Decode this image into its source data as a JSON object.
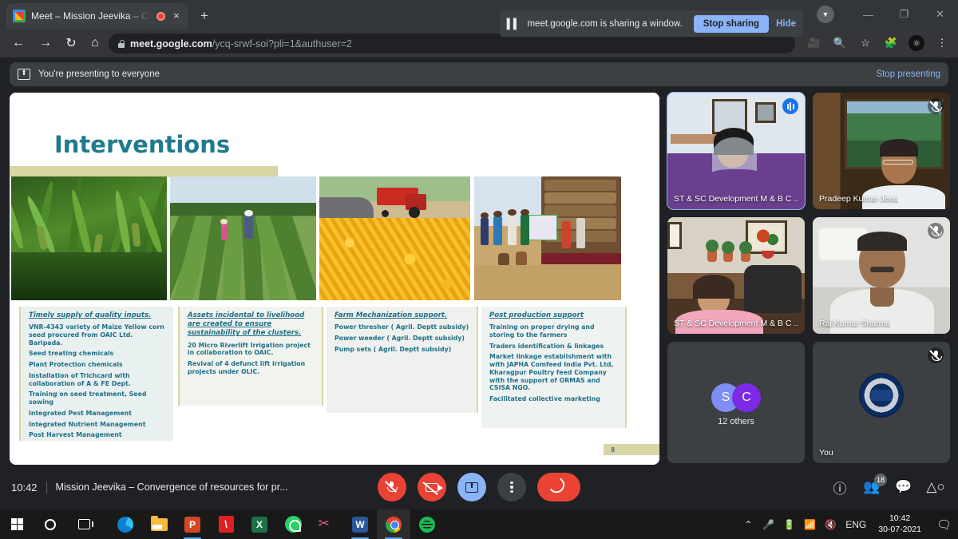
{
  "browser": {
    "tab": {
      "title": "Meet – Mission Jeevika – Co",
      "favicon": "meet-favicon-icon",
      "recording_indicator": "recording-dot-icon",
      "close": "×"
    },
    "new_tab_label": "+",
    "nav": {
      "back": "←",
      "forward": "→",
      "reload": "↻",
      "home": "⌂"
    },
    "omnibox": {
      "secure_icon": "lock-icon",
      "url_host": "meet.google.com",
      "url_path": "/ycq-srwf-soi?pli=1&authuser=2"
    },
    "toolbar_icons": [
      "camera-icon",
      "search-icon",
      "star-icon",
      "extensions-icon",
      "profile-avatar-icon",
      "menu-icon"
    ],
    "window_controls": {
      "minimize": "—",
      "maximize": "❐",
      "close": "✕"
    },
    "profile_chip": "▼"
  },
  "share_bubble": {
    "pause_icon": "pause-icon",
    "message": "meet.google.com is sharing a window.",
    "stop_label": "Stop sharing",
    "hide_label": "Hide"
  },
  "presenting_banner": {
    "icon": "present-screen-icon",
    "text": "You're presenting to everyone",
    "stop_label": "Stop presenting"
  },
  "slide": {
    "title": "Interventions",
    "page_number": "8",
    "photos": [
      {
        "alt": "maize-crop-closeup",
        "caption": ""
      },
      {
        "alt": "farmers-in-crop-field",
        "caption": ""
      },
      {
        "alt": "harvested-maize-cobs-heap-with-tractor",
        "caption": ""
      },
      {
        "alt": "villagers-loading-sacks-onto-truck",
        "caption": ""
      }
    ],
    "columns": [
      {
        "heading": "Timely supply of quality inputs.",
        "items": [
          "VNR-4343 variety of Maize Yellow corn seed procured from OAIC Ltd. Baripada.",
          "Seed treating chemicals",
          "Plant Protection chemicals",
          "Installation of Trichcard with collaboration  of A & FE Dept.",
          "Training on seed treatment, Seed sowing",
          "Integrated Pest Management",
          "Integrated Nutrient Management",
          "Post Harvest Management"
        ]
      },
      {
        "heading": "Assets incidental to livelihood are created to ensure sustainability of the clusters.",
        "items": [
          "20 Micro Riverlift Irrigation project in collaboration to OAIC.",
          "Revival of 4 defunct lift irrigation projects under OLIC."
        ]
      },
      {
        "heading": "Farm Mechanization support.",
        "items": [
          "Power thresher ( Agril. Deptt subsidy)",
          "Power weeder ( Agril. Deptt subsidy)",
          "Pump sets ( Agril. Deptt subsidy)"
        ]
      },
      {
        "heading": "Post production support",
        "items": [
          "Training on proper drying and  storing to the  farmers",
          "Traders identification & linkages",
          "Market linkage establishment with with  JAPHA Comfeed India Pvt. Ltd, Kharagpur Poultry feed Company with the support of ORMAS and CSISA NGO.",
          "Facilitated collective marketing"
        ]
      }
    ]
  },
  "participants": [
    {
      "name": "ST & SC Development M & B C ...",
      "status": "speaking",
      "badge_icon": "audio-wave-icon",
      "active": true
    },
    {
      "name": "Pradeep Kumar Jena",
      "status": "muted",
      "badge_icon": "mic-off-icon",
      "active": false
    },
    {
      "name": "ST & SC Development M & B C ...",
      "status": "none",
      "badge_icon": "",
      "active": false
    },
    {
      "name": "Raj Kumar Sharma",
      "status": "muted",
      "badge_icon": "mic-off-icon",
      "active": false
    }
  ],
  "others_tile": {
    "avatars": [
      {
        "initial": "S",
        "color": "#7e8ef5"
      },
      {
        "initial": "C",
        "color": "#7d2ae8"
      }
    ],
    "label": "12 others"
  },
  "you_tile": {
    "name": "You",
    "status": "muted",
    "badge_icon": "mic-off-icon",
    "logo": "government-emblem-logo"
  },
  "meet_controls": {
    "time": "10:42",
    "meeting_title": "Mission Jeevika – Convergence of resources for pr...",
    "buttons": [
      {
        "name": "mic-off-button",
        "icon": "mic-off-icon",
        "state": "off"
      },
      {
        "name": "camera-off-button",
        "icon": "camera-off-icon",
        "state": "off"
      },
      {
        "name": "present-now-button",
        "icon": "present-screen-icon",
        "state": "active"
      },
      {
        "name": "more-options-button",
        "icon": "more-vertical-icon",
        "state": "normal"
      },
      {
        "name": "leave-call-button",
        "icon": "hangup-icon",
        "state": "danger"
      }
    ],
    "right_icons": [
      {
        "name": "meeting-details-icon",
        "glyph": "ⓘ",
        "badge": ""
      },
      {
        "name": "show-everyone-icon",
        "glyph": "people",
        "badge": "18"
      },
      {
        "name": "chat-icon",
        "glyph": "chat",
        "badge": ""
      },
      {
        "name": "activities-icon",
        "glyph": "shapes",
        "badge": ""
      }
    ]
  },
  "taskbar": {
    "items": [
      {
        "name": "start-button",
        "icon": "windows-logo-icon"
      },
      {
        "name": "cortana-search",
        "icon": "circle-search-icon"
      },
      {
        "name": "task-view",
        "icon": "task-view-icon"
      },
      {
        "name": "microsoft-edge",
        "icon": "edge-icon"
      },
      {
        "name": "file-explorer",
        "icon": "folder-icon"
      },
      {
        "name": "powerpoint",
        "icon": "powerpoint-icon",
        "label": "P"
      },
      {
        "name": "adobe-acrobat",
        "icon": "acrobat-icon",
        "label": "ᴀ"
      },
      {
        "name": "excel",
        "icon": "excel-icon",
        "label": "X"
      },
      {
        "name": "whatsapp",
        "icon": "whatsapp-icon"
      },
      {
        "name": "snipping-tool",
        "icon": "scissors-icon"
      },
      {
        "name": "word",
        "icon": "word-icon",
        "label": "W"
      },
      {
        "name": "google-chrome",
        "icon": "chrome-icon"
      },
      {
        "name": "spotify",
        "icon": "spotify-icon"
      }
    ],
    "tray": {
      "chevron": "⌃",
      "icons": [
        "microphone-icon",
        "battery-icon",
        "wifi-icon",
        "volume-muted-icon"
      ],
      "language": "ENG",
      "time": "10:42",
      "date": "30-07-2021",
      "notification": "□"
    }
  },
  "colors": {
    "accent_blue": "#8ab4f8",
    "danger_red": "#ea4335",
    "slide_teal": "#1f7a8c",
    "slide_khaki": "#d9d6a5",
    "meet_bg": "#202124"
  }
}
